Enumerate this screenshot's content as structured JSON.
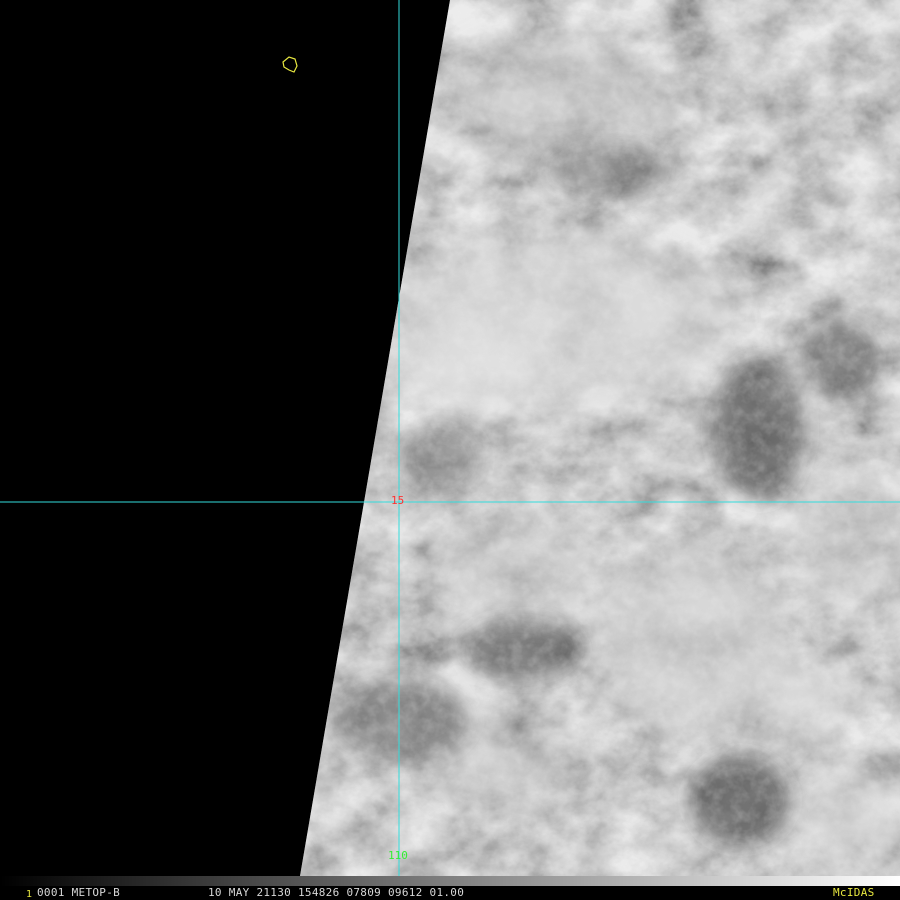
{
  "colors": {
    "background": "#000000",
    "gridline": "#33dddd",
    "latitude_label": "#ff3030",
    "longitude_label": "#33ee33",
    "coastline": "#e8e840",
    "status_text": "#d8d8d8",
    "frame_number": "#e8e840",
    "brand": "#e8e840"
  },
  "gridlines": {
    "latitude_label": "15",
    "longitude_label": "110"
  },
  "status_bar": {
    "frame_number": "1",
    "left_text": "0001 METOP-B",
    "right_text": "10 MAY 21130 154826 07809 09612 01.00",
    "brand": "McIDAS"
  }
}
